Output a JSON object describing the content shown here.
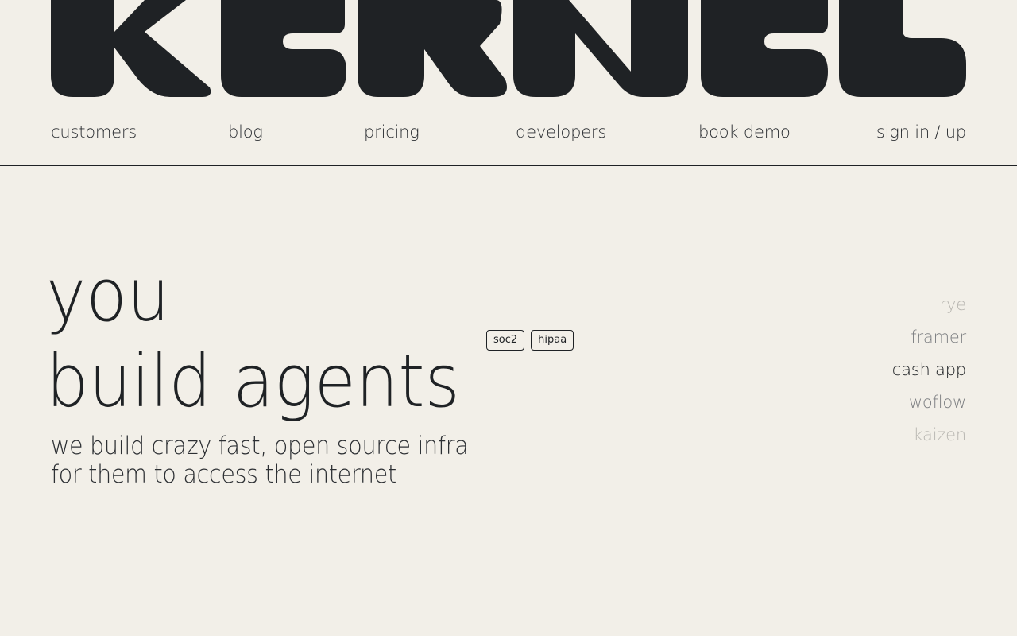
{
  "brand": {
    "logo_text": "KERNEL"
  },
  "nav": {
    "items": [
      {
        "label": "customers"
      },
      {
        "label": "blog"
      },
      {
        "label": "pricing"
      },
      {
        "label": "developers"
      },
      {
        "label": "book demo"
      },
      {
        "label": "sign in / up"
      }
    ]
  },
  "hero": {
    "line1": "you",
    "line2": "build agents",
    "subtitle_line1": "we build crazy fast, open source infra",
    "subtitle_line2": "for them to access the internet",
    "badges": [
      "soc2",
      "hipaa"
    ]
  },
  "customers": {
    "items": [
      {
        "name": "rye",
        "color": "#b9b7b2"
      },
      {
        "name": "framer",
        "color": "#7d7f82"
      },
      {
        "name": "cash app",
        "color": "#1f2225"
      },
      {
        "name": "woflow",
        "color": "#7d7f82"
      },
      {
        "name": "kaizen",
        "color": "#b9b7b2"
      }
    ]
  },
  "colors": {
    "background": "#f2efe8",
    "ink": "#1f2225"
  }
}
